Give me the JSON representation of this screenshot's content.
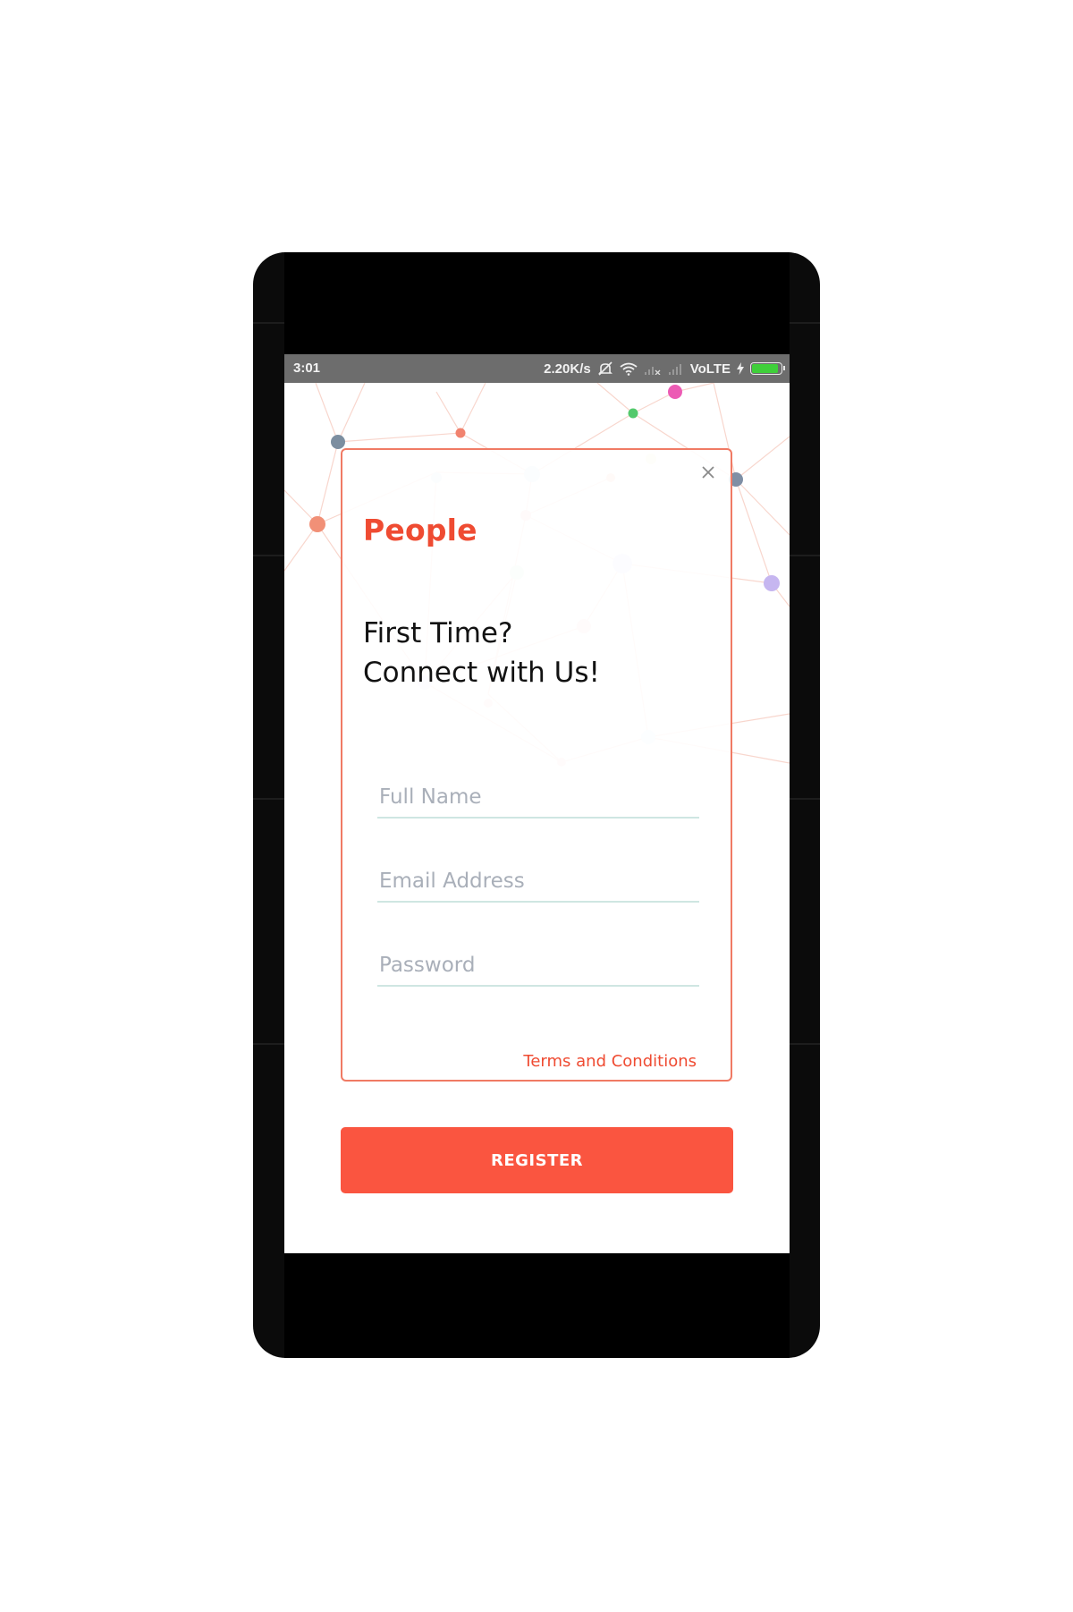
{
  "status_bar": {
    "time": "3:01",
    "speed": "2.20K/s",
    "network": "VoLTE",
    "battery_level": 0.9
  },
  "app": {
    "brand": "People",
    "headline_line1": "First Time?",
    "headline_line2": "Connect with Us!"
  },
  "form": {
    "full_name_placeholder": "Full Name",
    "email_placeholder": "Email Address",
    "password_placeholder": "Password",
    "full_name_value": "",
    "email_value": "",
    "password_value": "",
    "terms_link": "Terms and Conditions",
    "register_label": "REGISTER"
  },
  "icons": {
    "close": "close-icon",
    "mute": "mute-icon",
    "wifi": "wifi-icon",
    "signal": "signal-icon",
    "charging": "charging-icon",
    "battery": "battery-icon"
  },
  "colors": {
    "accent": "#ef4b32",
    "button": "#fa5540",
    "status_bar": "#6d6d6d",
    "field_line": "#cfe6e2"
  }
}
